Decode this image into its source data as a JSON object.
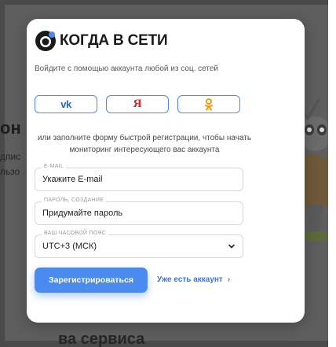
{
  "background": {
    "heading_fragment": "он",
    "line1_fragment": "дпис",
    "line2_fragment": "льзо",
    "bottom_fragment": "ва сервиса"
  },
  "modal": {
    "logo_text": "КОГДА В СЕТИ",
    "subtitle": "Войдите с помощью аккаунта любой из соц. сетей",
    "social": {
      "vk_label": "vk",
      "yandex_label": "Я",
      "ok_label": "ок"
    },
    "hint_line1": "или заполните форму быстрой регистрации, чтобы начать",
    "hint_line2": "мониторинг интересующего вас аккаунта",
    "fields": {
      "email": {
        "label": "E-MAIL",
        "value": "Укажите E-mail"
      },
      "password": {
        "label": "ПАРОЛЬ, СОЗДАНИЕ",
        "value": "Придумайте пароль"
      },
      "timezone": {
        "label": "ВАШ ЧАСОВОЙ ПОЯС",
        "value": "UTC+3 (МСК)"
      }
    },
    "register_label": "Зарегистрироваться",
    "login_label": "Уже есть аккаунт",
    "login_arrow": "›"
  },
  "colors": {
    "accent": "#4a8bf0",
    "vk": "#2366c8",
    "yandex": "#e02020",
    "ok": "#f59a12"
  }
}
